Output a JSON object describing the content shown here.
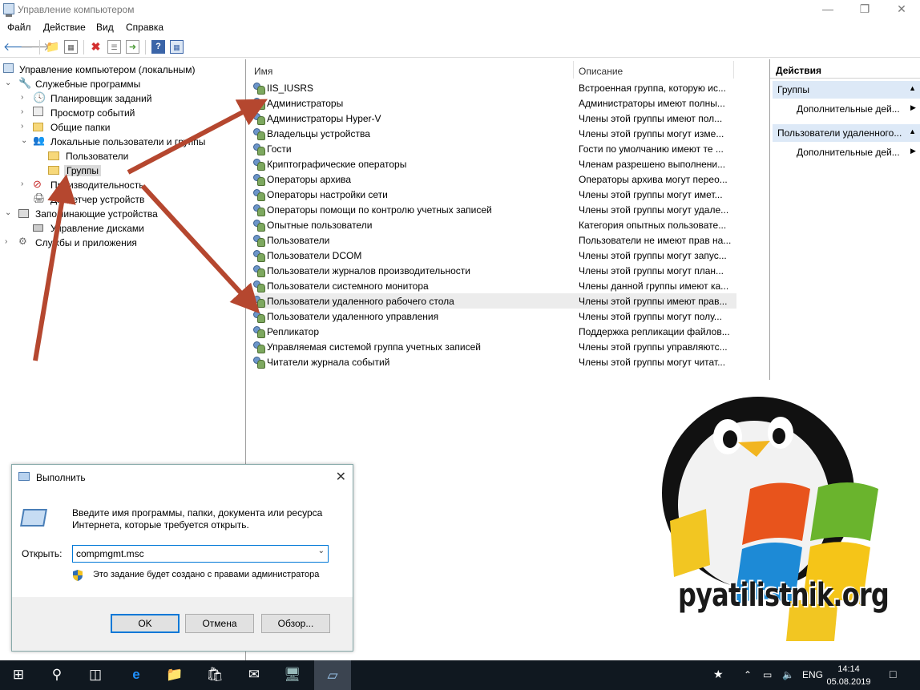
{
  "window": {
    "title": "Управление компьютером"
  },
  "menu": [
    "Файл",
    "Действие",
    "Вид",
    "Справка"
  ],
  "tree": [
    {
      "label": "Управление компьютером (локальным)",
      "level": 0
    },
    {
      "label": "Служебные программы",
      "level": 1
    },
    {
      "label": "Планировщик заданий",
      "level": 2
    },
    {
      "label": "Просмотр событий",
      "level": 2
    },
    {
      "label": "Общие папки",
      "level": 2
    },
    {
      "label": "Локальные пользователи и группы",
      "level": 2
    },
    {
      "label": "Пользователи",
      "level": 3
    },
    {
      "label": "Группы",
      "level": 3
    },
    {
      "label": "Производительность",
      "level": 2
    },
    {
      "label": "Диспетчер устройств",
      "level": 2
    },
    {
      "label": "Запоминающие устройства",
      "level": 1
    },
    {
      "label": "Управление дисками",
      "level": 2
    },
    {
      "label": "Службы и приложения",
      "level": 1
    }
  ],
  "columns": {
    "name": "Имя",
    "description": "Описание"
  },
  "groups": [
    {
      "name": "IIS_IUSRS",
      "desc": "Встроенная группа, которую ис..."
    },
    {
      "name": "Администраторы",
      "desc": "Администраторы имеют полны..."
    },
    {
      "name": "Администраторы Hyper-V",
      "desc": "Члены этой группы имеют пол..."
    },
    {
      "name": "Владельцы устройства",
      "desc": "Члены этой группы могут изме..."
    },
    {
      "name": "Гости",
      "desc": "Гости по умолчанию имеют те ..."
    },
    {
      "name": "Криптографические операторы",
      "desc": "Членам разрешено выполнени..."
    },
    {
      "name": "Операторы архива",
      "desc": "Операторы архива могут перео..."
    },
    {
      "name": "Операторы настройки сети",
      "desc": "Члены этой группы могут имет..."
    },
    {
      "name": "Операторы помощи по контролю учетных записей",
      "desc": "Члены этой группы могут удале..."
    },
    {
      "name": "Опытные пользователи",
      "desc": "Категория опытных пользовате..."
    },
    {
      "name": "Пользователи",
      "desc": "Пользователи не имеют прав на..."
    },
    {
      "name": "Пользователи DCOM",
      "desc": "Члены этой группы могут запус..."
    },
    {
      "name": "Пользователи журналов производительности",
      "desc": "Члены этой группы могут план..."
    },
    {
      "name": "Пользователи системного монитора",
      "desc": "Члены данной группы имеют ка..."
    },
    {
      "name": "Пользователи удаленного рабочего стола",
      "desc": "Члены этой группы имеют прав..."
    },
    {
      "name": "Пользователи удаленного управления",
      "desc": "Члены этой группы могут полу..."
    },
    {
      "name": "Репликатор",
      "desc": "Поддержка репликации файлов..."
    },
    {
      "name": "Управляемая системой группа учетных записей",
      "desc": "Члены этой группы управляютс..."
    },
    {
      "name": "Читатели журнала событий",
      "desc": "Члены этой группы могут читат..."
    }
  ],
  "actions": {
    "title": "Действия",
    "sections": [
      {
        "header": "Группы",
        "item": "Дополнительные дей..."
      },
      {
        "header": "Пользователи удаленного...",
        "item": "Дополнительные дей..."
      }
    ]
  },
  "run_dialog": {
    "title": "Выполнить",
    "description": "Введите имя программы, папки, документа или ресурса Интернета, которые требуется открыть.",
    "open_label": "Открыть:",
    "input_value": "compmgmt.msc",
    "admin_note": "Это задание будет создано с правами администратора",
    "ok": "OK",
    "cancel": "Отмена",
    "browse": "Обзор..."
  },
  "taskbar": {
    "lang": "ENG",
    "time": "14:14",
    "date": "05.08.2019"
  },
  "watermark": "pyatilistnik.org",
  "colors": {
    "accent": "#0078d7",
    "arrow": "#b5472f",
    "taskbar": "#101820"
  }
}
